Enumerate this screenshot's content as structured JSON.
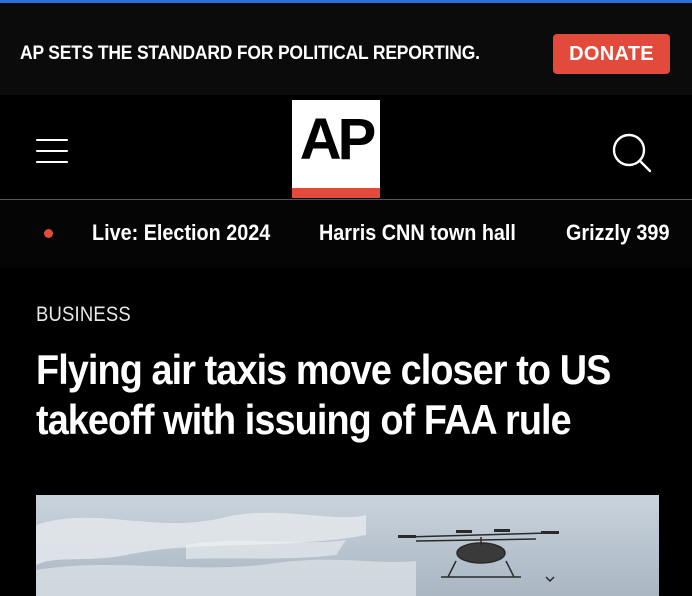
{
  "promo": {
    "text": "AP SETS THE STANDARD FOR POLITICAL REPORTING.",
    "donate_label": "DONATE"
  },
  "header": {
    "logo_text": "AP",
    "menu_icon": "hamburger-menu-icon",
    "search_icon": "search-icon"
  },
  "trending": {
    "items": [
      "Live: Election 2024",
      "Harris CNN town hall",
      "Grizzly 399"
    ]
  },
  "article": {
    "section": "BUSINESS",
    "headline": "Flying air taxis move closer to US takeoff with issuing of FAA rule"
  },
  "colors": {
    "accent_red": "#e24b3b",
    "background": "#000000",
    "top_line_blue": "#2f6fe0"
  }
}
